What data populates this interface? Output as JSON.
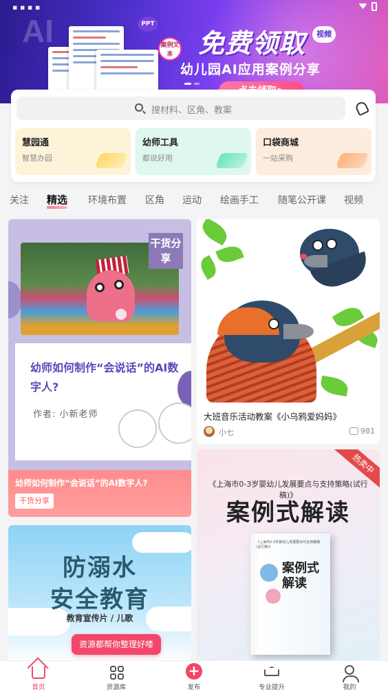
{
  "banner": {
    "logo_text": "AI",
    "ppt_badge": "PPT",
    "case_badge": "案例文本",
    "title": "免费领取",
    "video_badge": "视频",
    "subtitle": "幼儿园AI应用案例分享",
    "claim_button": "点击领取>"
  },
  "search": {
    "placeholder": "搜材料、区角、教案"
  },
  "shortcuts": [
    {
      "title": "慧园通",
      "subtitle": "智慧办园"
    },
    {
      "title": "幼师工具",
      "subtitle": "都说好用"
    },
    {
      "title": "口袋商城",
      "subtitle": "一站采购"
    }
  ],
  "tabs": [
    "关注",
    "精选",
    "环境布置",
    "区角",
    "运动",
    "绘画手工",
    "随笔公开课",
    "视频"
  ],
  "active_tab": "精选",
  "feed": {
    "card1": {
      "badge": "干货分享",
      "question": "幼师如何制作“会说话”的AI数字人?",
      "author_line": "作者: 小新老师",
      "footer_title": "幼师如何制作“会说话”的AI数字人?",
      "footer_tag": "干货分享"
    },
    "card2": {
      "title": "大班音乐活动教案《小乌鸦爱妈妈》",
      "author": "小七",
      "comments": "981"
    },
    "card3": {
      "line1": "防溺水",
      "line2": "安全教育",
      "line3": "教育宣传片 / 儿歌",
      "pill": "资源都帮你整理好喽"
    },
    "card4": {
      "ribbon": "热卖中",
      "subtitle": "《上海市0-3岁婴幼儿发展要点与支持策略(试行稿)》",
      "headline": "案例式解读",
      "book_small": "《上海市0-3岁婴幼儿发展要点与支持策略(试行稿)》",
      "book_title": "案例式解读"
    }
  },
  "bottom_nav": [
    {
      "label": "首页",
      "icon": "home-icon"
    },
    {
      "label": "资源库",
      "icon": "grid-icon"
    },
    {
      "label": "发布",
      "icon": "plus-icon"
    },
    {
      "label": "专业提升",
      "icon": "graduation-cap-icon"
    },
    {
      "label": "我的",
      "icon": "user-icon"
    }
  ],
  "colors": {
    "accent": "#f2466a",
    "banner_start": "#2b1c8f",
    "banner_end": "#e05cb8",
    "card_purple": "#5f44b8"
  }
}
